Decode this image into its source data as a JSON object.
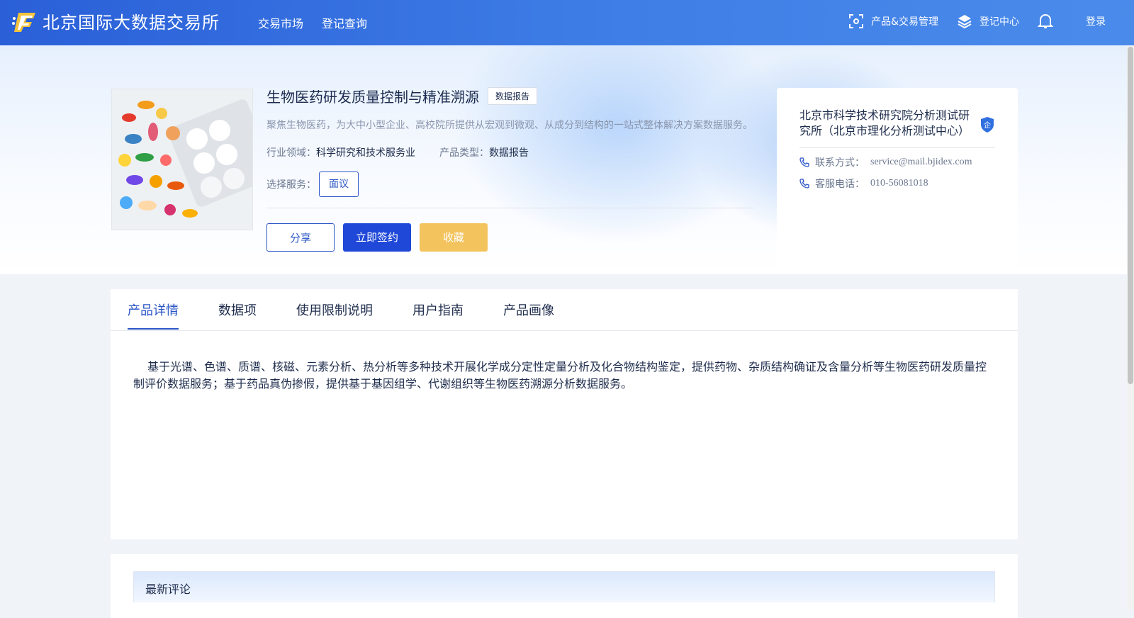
{
  "header": {
    "brand": "北京国际大数据交易所",
    "nav": [
      "交易市场",
      "登记查询"
    ],
    "product_mgmt": "产品&交易管理",
    "register_center": "登记中心",
    "login": "登录"
  },
  "product": {
    "title": "生物医药研发质量控制与精准溯源",
    "tag": "数据报告",
    "description": "聚焦生物医药，为大中小型企业、高校院所提供从宏观到微观、从成分到结构的一站式整体解决方案数据服务。",
    "industry_label": "行业领域：",
    "industry_value": "科学研究和技术服务业",
    "type_label": "产品类型：",
    "type_value": "数据报告",
    "service_label": "选择服务：",
    "service_option": "面议",
    "actions": {
      "share": "分享",
      "sign": "立即签约",
      "favorite": "收藏"
    }
  },
  "company": {
    "name": "北京市科学技术研究院分析测试研究所（北京市理化分析测试中心）",
    "badge": "企",
    "contact_label": "联系方式：",
    "contact_value": "service@mail.bjidex.com",
    "phone_label": "客服电话：",
    "phone_value": "010-56081018"
  },
  "tabs": [
    "产品详情",
    "数据项",
    "使用限制说明",
    "用户指南",
    "产品画像"
  ],
  "active_tab": "产品详情",
  "detail_text": "基于光谱、色谱、质谱、核磁、元素分析、热分析等多种技术开展化学成分定性定量分析及化合物结构鉴定，提供药物、杂质结构确证及含量分析等生物医药研发质量控制评价数据服务；基于药品真伪掺假，提供基于基因组学、代谢组织等生物医药溯源分析数据服务。",
  "comments": {
    "title": "最新评论"
  },
  "colors": {
    "primary": "#2a55c6",
    "header": "#3f7ee6",
    "favorite": "#f3c35e",
    "sign": "#1f48d8"
  },
  "icons": [
    "logo-icon",
    "scan-icon",
    "layers-icon",
    "bell-icon",
    "phone-icon",
    "enterprise-badge-icon"
  ]
}
